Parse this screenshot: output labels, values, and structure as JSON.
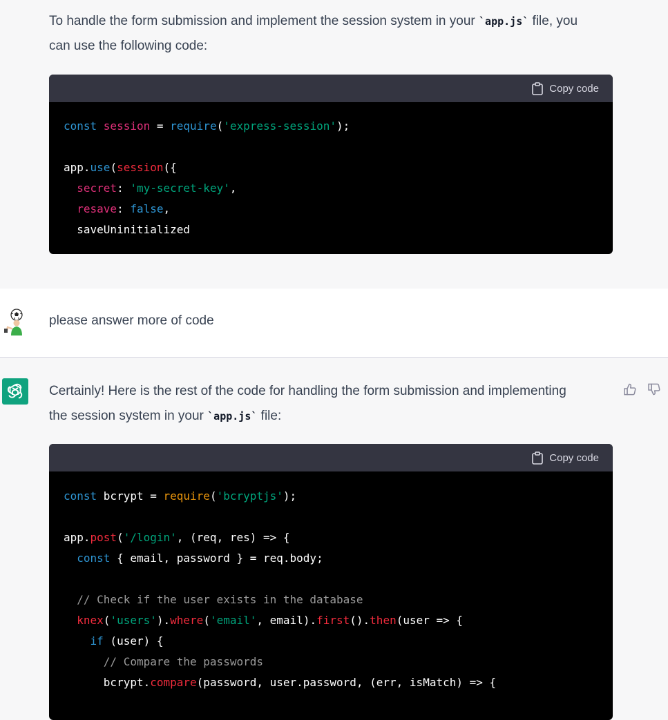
{
  "top_message": {
    "intro_before_code": "To handle the form submission and implement the session system in your ",
    "intro_code": "`app.js`",
    "intro_after_code_line1": " file, you",
    "intro_line2": "can use the following code:",
    "code_block": {
      "copy_label": "Copy code",
      "lines": [
        [
          {
            "t": "const ",
            "c": "kw"
          },
          {
            "t": "session",
            "c": "var"
          },
          {
            "t": " = ",
            "c": "plain"
          },
          {
            "t": "require",
            "c": "kw"
          },
          {
            "t": "(",
            "c": "plain"
          },
          {
            "t": "'express-session'",
            "c": "str"
          },
          {
            "t": ");",
            "c": "plain"
          }
        ],
        [],
        [
          {
            "t": "app.",
            "c": "plain"
          },
          {
            "t": "use",
            "c": "kw"
          },
          {
            "t": "(",
            "c": "plain"
          },
          {
            "t": "session",
            "c": "fn"
          },
          {
            "t": "({",
            "c": "plain"
          }
        ],
        [
          {
            "t": "  secret",
            "c": "var"
          },
          {
            "t": ": ",
            "c": "plain"
          },
          {
            "t": "'my-secret-key'",
            "c": "str"
          },
          {
            "t": ",",
            "c": "plain"
          }
        ],
        [
          {
            "t": "  resave",
            "c": "var"
          },
          {
            "t": ": ",
            "c": "plain"
          },
          {
            "t": "false",
            "c": "kw"
          },
          {
            "t": ",",
            "c": "plain"
          }
        ],
        [
          {
            "t": "  saveUninitialized",
            "c": "plain"
          }
        ]
      ]
    }
  },
  "user_message": {
    "text": "please answer more of code",
    "avatar_icon": "soccer-player-avatar"
  },
  "bot_message": {
    "line1": "Certainly! Here is the rest of the code for handling the form submission and implementing",
    "line2_before_code": "the session system in your ",
    "line2_code": "`app.js`",
    "line2_after_code": " file:",
    "avatar_icon": "openai-logo-icon",
    "thumbs_up_icon": "thumbs-up-icon",
    "thumbs_down_icon": "thumbs-down-icon",
    "code_block": {
      "copy_label": "Copy code",
      "lines": [
        [
          {
            "t": "const ",
            "c": "kw"
          },
          {
            "t": "bcrypt",
            "c": "plain"
          },
          {
            "t": " = ",
            "c": "plain"
          },
          {
            "t": "require",
            "c": "call"
          },
          {
            "t": "(",
            "c": "plain"
          },
          {
            "t": "'bcryptjs'",
            "c": "str"
          },
          {
            "t": ");",
            "c": "plain"
          }
        ],
        [],
        [
          {
            "t": "app.",
            "c": "plain"
          },
          {
            "t": "post",
            "c": "fn"
          },
          {
            "t": "(",
            "c": "plain"
          },
          {
            "t": "'/login'",
            "c": "str"
          },
          {
            "t": ", (req, res) => {",
            "c": "plain"
          }
        ],
        [
          {
            "t": "  const",
            "c": "kw"
          },
          {
            "t": " { email, password } = req.",
            "c": "plain"
          },
          {
            "t": "body",
            "c": "plain"
          },
          {
            "t": ";",
            "c": "plain"
          }
        ],
        [],
        [
          {
            "t": "  // Check if the user exists in the database",
            "c": "cm"
          }
        ],
        [
          {
            "t": "  knex",
            "c": "fn"
          },
          {
            "t": "(",
            "c": "plain"
          },
          {
            "t": "'users'",
            "c": "str"
          },
          {
            "t": ").",
            "c": "plain"
          },
          {
            "t": "where",
            "c": "fn"
          },
          {
            "t": "(",
            "c": "plain"
          },
          {
            "t": "'email'",
            "c": "str"
          },
          {
            "t": ", email).",
            "c": "plain"
          },
          {
            "t": "first",
            "c": "fn"
          },
          {
            "t": "().",
            "c": "plain"
          },
          {
            "t": "then",
            "c": "fn"
          },
          {
            "t": "(user => {",
            "c": "plain"
          }
        ],
        [
          {
            "t": "    if",
            "c": "kw"
          },
          {
            "t": " (user) {",
            "c": "plain"
          }
        ],
        [
          {
            "t": "      // Compare the passwords",
            "c": "cm"
          }
        ],
        [
          {
            "t": "      bcrypt.",
            "c": "plain"
          },
          {
            "t": "compare",
            "c": "fn"
          },
          {
            "t": "(password, user.",
            "c": "plain"
          },
          {
            "t": "password",
            "c": "plain"
          },
          {
            "t": ", (err, isMatch) => {",
            "c": "plain"
          }
        ]
      ]
    }
  },
  "colors": {
    "page_bg": "#f7f7f8",
    "user_bg": "#ffffff",
    "code_header_bg": "#343541",
    "code_bg": "#000000",
    "openai_green": "#10a37f"
  }
}
